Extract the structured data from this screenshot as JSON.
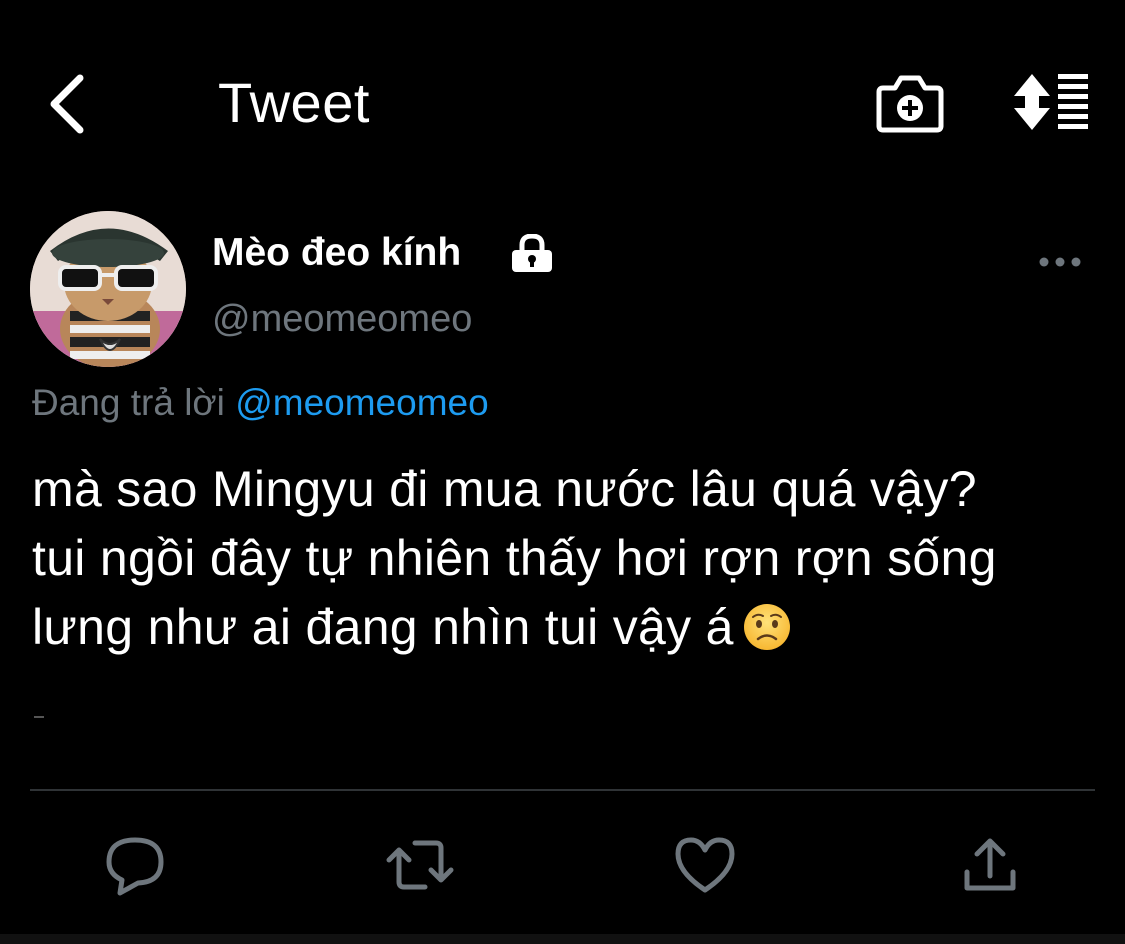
{
  "header": {
    "title": "Tweet",
    "back_icon": "chevron-left-icon",
    "camera_icon": "camera-add-icon",
    "sort_icon": "sort-list-icon"
  },
  "tweet": {
    "author": {
      "display_name": "Mèo đeo kính",
      "handle": "@meomeomeo",
      "protected": true,
      "avatar": "cat-with-sunglasses-avatar"
    },
    "reply_prefix": "Đang trả lời",
    "reply_to": "@meomeomeo",
    "body_lines": [
      "mà sao Mingyu đi mua nước lâu quá vậy?",
      "tui ngồi đây tự nhiên thấy hơi rợn rợn sống",
      "lưng như ai đang nhìn tui vậy á"
    ],
    "emoji": "worried-face-emoji"
  },
  "actions": {
    "reply_icon": "comment-icon",
    "retweet_icon": "retweet-icon",
    "like_icon": "heart-icon",
    "share_icon": "share-icon"
  },
  "colors": {
    "background": "#000000",
    "text": "#ffffff",
    "secondary": "#6e767d",
    "accent": "#1d9bf0",
    "divider": "#2f3336"
  }
}
